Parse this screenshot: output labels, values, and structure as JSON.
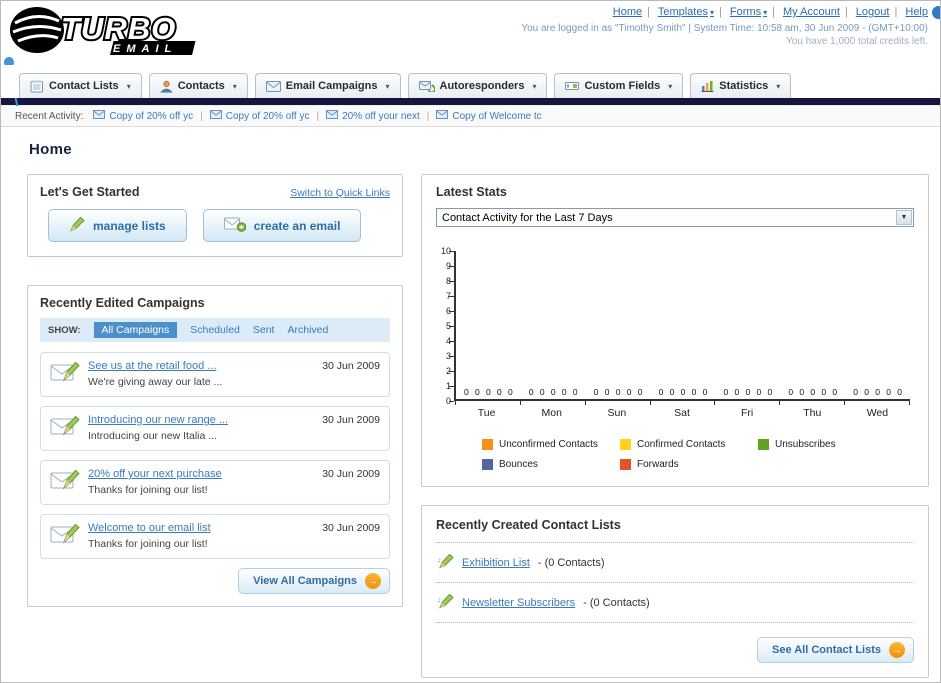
{
  "header": {
    "logo": {
      "title": "TURBO",
      "subtitle": "EMAIL"
    },
    "nav": [
      {
        "label": "Home"
      },
      {
        "label": "Templates"
      },
      {
        "label": "Forms"
      },
      {
        "label": "My Account"
      },
      {
        "label": "Logout"
      },
      {
        "label": "Help"
      }
    ],
    "separator": "|",
    "login_info": "You are logged in as \"Timothy Smith\" | System Time: 10:58 am, 30 Jun 2009 - (GMT+10:00)",
    "credits_info": "You have 1,000 total credits left."
  },
  "tabs": [
    {
      "label": "Contact Lists"
    },
    {
      "label": "Contacts"
    },
    {
      "label": "Email Campaigns"
    },
    {
      "label": "Autoresponders"
    },
    {
      "label": "Custom Fields"
    },
    {
      "label": "Statistics"
    }
  ],
  "recent_activity": {
    "label": "Recent Activity:",
    "items": [
      {
        "text": "Copy of 20% off yc"
      },
      {
        "text": "Copy of 20% off yc"
      },
      {
        "text": "20% off your next"
      },
      {
        "text": "Copy of Welcome tc"
      }
    ]
  },
  "page": {
    "title": "Home"
  },
  "get_started": {
    "title": "Let's Get Started",
    "switch_link": "Switch to Quick Links",
    "manage_lists_label": "manage lists",
    "create_email_label": "create an email"
  },
  "campaigns": {
    "title": "Recently Edited Campaigns",
    "show_label": "SHOW:",
    "filters": [
      {
        "label": "All Campaigns"
      },
      {
        "label": "Scheduled"
      },
      {
        "label": "Sent"
      },
      {
        "label": "Archived"
      }
    ],
    "items": [
      {
        "title": "See us at the retail food ...",
        "subtitle": "We're giving away our late ...",
        "date": "30 Jun 2009"
      },
      {
        "title": "Introducing our new range ...",
        "subtitle": "Introducing our new Italia ...",
        "date": "30 Jun 2009"
      },
      {
        "title": "20% off your next purchase",
        "subtitle": "Thanks for joining our list!",
        "date": "30 Jun 2009"
      },
      {
        "title": "Welcome to our email list",
        "subtitle": "Thanks for joining our list!",
        "date": "30 Jun 2009"
      }
    ],
    "view_all_label": "View All Campaigns",
    "arrow": "→"
  },
  "stats": {
    "title": "Latest Stats",
    "selector_value": "Contact Activity for the Last 7 Days",
    "chart_data": {
      "type": "bar",
      "title": "Contact Activity for the Last 7 Days",
      "categories": [
        "Tue",
        "Mon",
        "Sun",
        "Sat",
        "Fri",
        "Thu",
        "Wed"
      ],
      "series": [
        {
          "name": "Unconfirmed Contacts",
          "color": "#f79114",
          "values": [
            0,
            0,
            0,
            0,
            0,
            0,
            0
          ]
        },
        {
          "name": "Confirmed Contacts",
          "color": "#ffd21e",
          "values": [
            0,
            0,
            0,
            0,
            0,
            0,
            0
          ]
        },
        {
          "name": "Unsubscribes",
          "color": "#5fa321",
          "values": [
            0,
            0,
            0,
            0,
            0,
            0,
            0
          ]
        },
        {
          "name": "Bounces",
          "color": "#53679e",
          "values": [
            0,
            0,
            0,
            0,
            0,
            0,
            0
          ]
        },
        {
          "name": "Forwards",
          "color": "#e2552b",
          "values": [
            0,
            0,
            0,
            0,
            0,
            0,
            0
          ]
        }
      ],
      "ylim": [
        0,
        10
      ],
      "ytick_step": 1,
      "show_value_labels": true,
      "grid": false,
      "legend_position": "bottom"
    }
  },
  "contact_lists": {
    "title": "Recently Created Contact Lists",
    "items": [
      {
        "name": "Exhibition List",
        "suffix": "- (0 Contacts)"
      },
      {
        "name": "Newsletter Subscribers",
        "suffix": "- (0 Contacts)"
      }
    ],
    "see_all_label": "See All Contact Lists",
    "arrow": "→"
  }
}
